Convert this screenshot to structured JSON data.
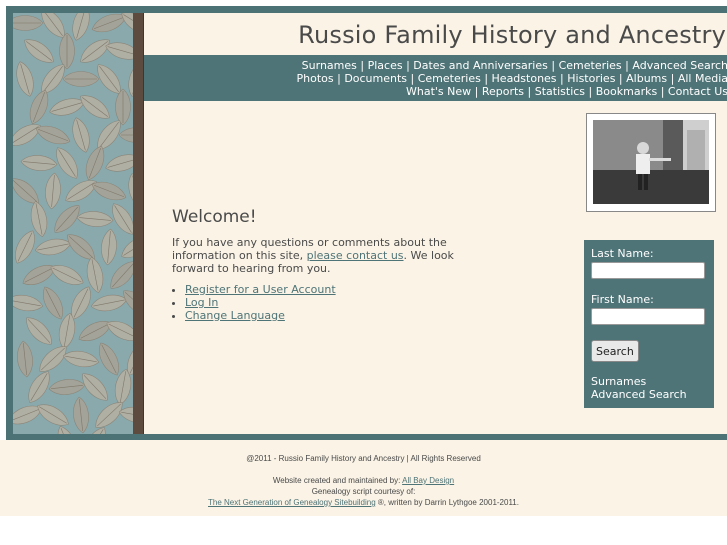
{
  "site": {
    "title": "Russio Family History and Ancestry"
  },
  "nav": {
    "line1": [
      "Surnames",
      "Places",
      "Dates and Anniversaries",
      "Cemeteries",
      "Advanced Search"
    ],
    "line2": [
      "Photos",
      "Documents",
      "Cemeteries",
      "Headstones",
      "Histories",
      "Albums",
      "All Media"
    ],
    "line3": [
      "What's New",
      "Reports",
      "Statistics",
      "Bookmarks",
      "Contact Us"
    ],
    "separator": "|"
  },
  "main": {
    "welcome": "Welcome!",
    "intro_before": "If you have any questions or comments about the information on this site, ",
    "intro_link": "please contact us",
    "intro_after": ". We look forward to hearing from you.",
    "links": [
      "Register for a User Account",
      "Log In",
      "Change Language"
    ]
  },
  "search_panel": {
    "last_name_label": "Last Name:",
    "last_name_value": "",
    "first_name_label": "First Name:",
    "first_name_value": "",
    "button_label": "Search",
    "link_surnames": "Surnames",
    "link_advanced": "Advanced Search"
  },
  "footer": {
    "copyright": "@2011 - Russio Family History and Ancestry | All Rights Reserved",
    "created_prefix": "Website created and maintained by: ",
    "created_link": "All Bay Design",
    "script_line": "Genealogy script courtesy of:",
    "tng_link": "The Next Generation of Genealogy Sitebuilding",
    "tng_suffix": " ®, written by Darrin Lythgoe 2001-2011."
  },
  "colors": {
    "accent": "#4f7477",
    "page_bg": "#faf3e6",
    "sidebar_brown": "#5c4b3e"
  },
  "icons": [
    "leaf-pattern-decoration"
  ]
}
